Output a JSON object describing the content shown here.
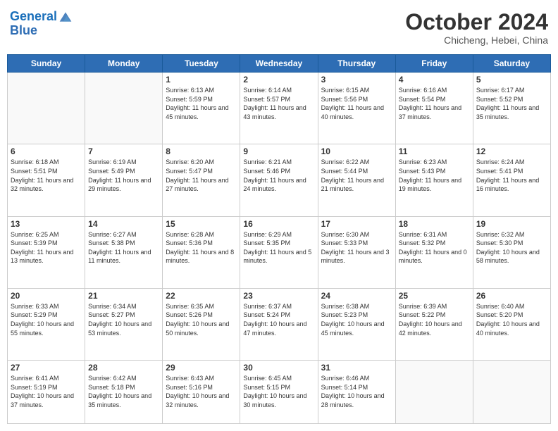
{
  "header": {
    "logo_line1": "General",
    "logo_line2": "Blue",
    "month": "October 2024",
    "location": "Chicheng, Hebei, China"
  },
  "weekdays": [
    "Sunday",
    "Monday",
    "Tuesday",
    "Wednesday",
    "Thursday",
    "Friday",
    "Saturday"
  ],
  "weeks": [
    [
      {
        "day": "",
        "info": ""
      },
      {
        "day": "",
        "info": ""
      },
      {
        "day": "1",
        "info": "Sunrise: 6:13 AM\nSunset: 5:59 PM\nDaylight: 11 hours and 45 minutes."
      },
      {
        "day": "2",
        "info": "Sunrise: 6:14 AM\nSunset: 5:57 PM\nDaylight: 11 hours and 43 minutes."
      },
      {
        "day": "3",
        "info": "Sunrise: 6:15 AM\nSunset: 5:56 PM\nDaylight: 11 hours and 40 minutes."
      },
      {
        "day": "4",
        "info": "Sunrise: 6:16 AM\nSunset: 5:54 PM\nDaylight: 11 hours and 37 minutes."
      },
      {
        "day": "5",
        "info": "Sunrise: 6:17 AM\nSunset: 5:52 PM\nDaylight: 11 hours and 35 minutes."
      }
    ],
    [
      {
        "day": "6",
        "info": "Sunrise: 6:18 AM\nSunset: 5:51 PM\nDaylight: 11 hours and 32 minutes."
      },
      {
        "day": "7",
        "info": "Sunrise: 6:19 AM\nSunset: 5:49 PM\nDaylight: 11 hours and 29 minutes."
      },
      {
        "day": "8",
        "info": "Sunrise: 6:20 AM\nSunset: 5:47 PM\nDaylight: 11 hours and 27 minutes."
      },
      {
        "day": "9",
        "info": "Sunrise: 6:21 AM\nSunset: 5:46 PM\nDaylight: 11 hours and 24 minutes."
      },
      {
        "day": "10",
        "info": "Sunrise: 6:22 AM\nSunset: 5:44 PM\nDaylight: 11 hours and 21 minutes."
      },
      {
        "day": "11",
        "info": "Sunrise: 6:23 AM\nSunset: 5:43 PM\nDaylight: 11 hours and 19 minutes."
      },
      {
        "day": "12",
        "info": "Sunrise: 6:24 AM\nSunset: 5:41 PM\nDaylight: 11 hours and 16 minutes."
      }
    ],
    [
      {
        "day": "13",
        "info": "Sunrise: 6:25 AM\nSunset: 5:39 PM\nDaylight: 11 hours and 13 minutes."
      },
      {
        "day": "14",
        "info": "Sunrise: 6:27 AM\nSunset: 5:38 PM\nDaylight: 11 hours and 11 minutes."
      },
      {
        "day": "15",
        "info": "Sunrise: 6:28 AM\nSunset: 5:36 PM\nDaylight: 11 hours and 8 minutes."
      },
      {
        "day": "16",
        "info": "Sunrise: 6:29 AM\nSunset: 5:35 PM\nDaylight: 11 hours and 5 minutes."
      },
      {
        "day": "17",
        "info": "Sunrise: 6:30 AM\nSunset: 5:33 PM\nDaylight: 11 hours and 3 minutes."
      },
      {
        "day": "18",
        "info": "Sunrise: 6:31 AM\nSunset: 5:32 PM\nDaylight: 11 hours and 0 minutes."
      },
      {
        "day": "19",
        "info": "Sunrise: 6:32 AM\nSunset: 5:30 PM\nDaylight: 10 hours and 58 minutes."
      }
    ],
    [
      {
        "day": "20",
        "info": "Sunrise: 6:33 AM\nSunset: 5:29 PM\nDaylight: 10 hours and 55 minutes."
      },
      {
        "day": "21",
        "info": "Sunrise: 6:34 AM\nSunset: 5:27 PM\nDaylight: 10 hours and 53 minutes."
      },
      {
        "day": "22",
        "info": "Sunrise: 6:35 AM\nSunset: 5:26 PM\nDaylight: 10 hours and 50 minutes."
      },
      {
        "day": "23",
        "info": "Sunrise: 6:37 AM\nSunset: 5:24 PM\nDaylight: 10 hours and 47 minutes."
      },
      {
        "day": "24",
        "info": "Sunrise: 6:38 AM\nSunset: 5:23 PM\nDaylight: 10 hours and 45 minutes."
      },
      {
        "day": "25",
        "info": "Sunrise: 6:39 AM\nSunset: 5:22 PM\nDaylight: 10 hours and 42 minutes."
      },
      {
        "day": "26",
        "info": "Sunrise: 6:40 AM\nSunset: 5:20 PM\nDaylight: 10 hours and 40 minutes."
      }
    ],
    [
      {
        "day": "27",
        "info": "Sunrise: 6:41 AM\nSunset: 5:19 PM\nDaylight: 10 hours and 37 minutes."
      },
      {
        "day": "28",
        "info": "Sunrise: 6:42 AM\nSunset: 5:18 PM\nDaylight: 10 hours and 35 minutes."
      },
      {
        "day": "29",
        "info": "Sunrise: 6:43 AM\nSunset: 5:16 PM\nDaylight: 10 hours and 32 minutes."
      },
      {
        "day": "30",
        "info": "Sunrise: 6:45 AM\nSunset: 5:15 PM\nDaylight: 10 hours and 30 minutes."
      },
      {
        "day": "31",
        "info": "Sunrise: 6:46 AM\nSunset: 5:14 PM\nDaylight: 10 hours and 28 minutes."
      },
      {
        "day": "",
        "info": ""
      },
      {
        "day": "",
        "info": ""
      }
    ]
  ]
}
